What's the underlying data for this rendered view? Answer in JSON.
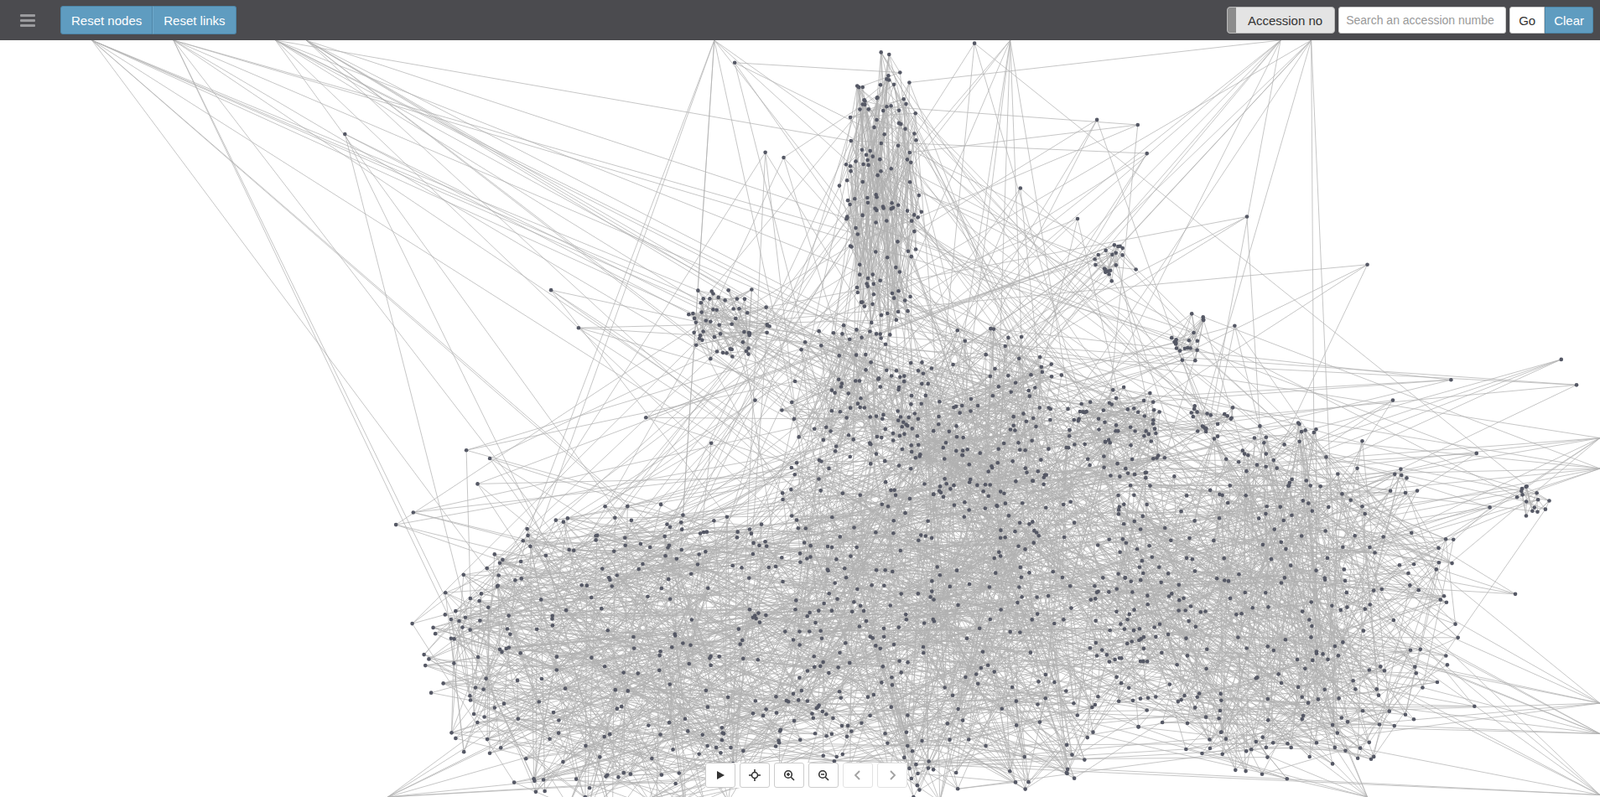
{
  "toolbar": {
    "buttons": [
      {
        "label": "Reset nodes"
      },
      {
        "label": "Reset links"
      }
    ]
  },
  "search": {
    "toggle_label": "Accession no",
    "toggle_on": false,
    "placeholder": "Search an accession numbe",
    "buttons": [
      "Go",
      "Clear"
    ]
  },
  "controls": [
    {
      "kind": "play",
      "disabled": false
    },
    {
      "kind": "center",
      "disabled": false
    },
    {
      "kind": "zoom-in",
      "disabled": false
    },
    {
      "kind": "zoom-out",
      "disabled": false
    },
    {
      "kind": "previous",
      "disabled": true
    },
    {
      "kind": "next",
      "disabled": true
    }
  ]
}
